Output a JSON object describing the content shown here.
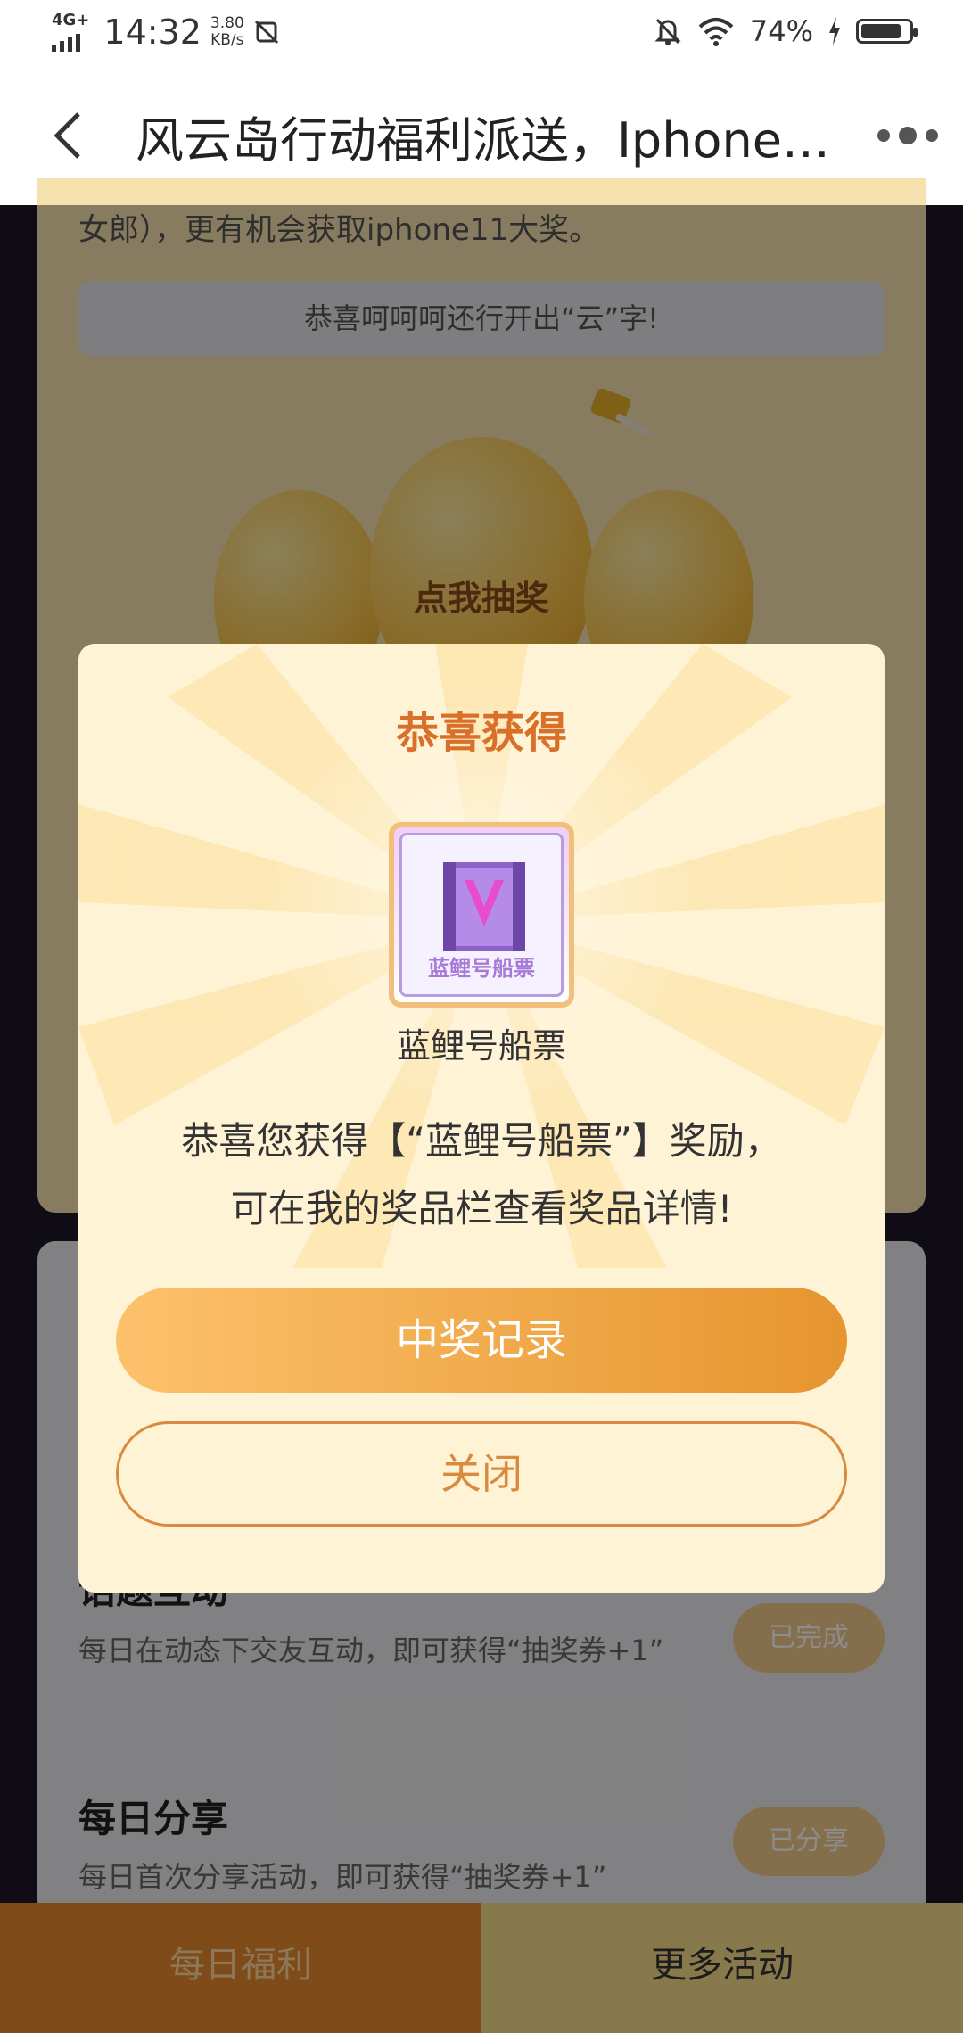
{
  "status_bar": {
    "network": "4G+",
    "time": "14:32",
    "speed_value": "3.80",
    "speed_unit": "KB/s",
    "battery": "74%"
  },
  "nav": {
    "title": "风云岛行动福利派送，Iphone…"
  },
  "page": {
    "desc": "女郎），更有机会获取iphone11大奖。",
    "notice": "恭喜呵呵呵还行开出“云”字!",
    "draw_label": "点我抽奖"
  },
  "tasks": [
    {
      "title": "话题互动",
      "desc": "每日在动态下交友互动，即可获得“抽奖券+1”",
      "button": "已完成"
    },
    {
      "title": "每日分享",
      "desc": "每日首次分享活动，即可获得“抽奖券+1”",
      "button": "已分享"
    }
  ],
  "tabs": [
    {
      "label": "每日福利"
    },
    {
      "label": "更多活动"
    }
  ],
  "dialog": {
    "title": "恭喜获得",
    "prize_image_text": "蓝鲤号船票",
    "prize_name": "蓝鲤号船票",
    "message_line1": "恭喜您获得【“蓝鲤号船票”】奖励，",
    "message_line2": "可在我的奖品栏查看奖品详情!",
    "primary_button": "中奖记录",
    "secondary_button": "关闭"
  },
  "colors": {
    "accent": "#e6952f",
    "title": "#d9702a",
    "dialog_bg": "#fff3d6"
  }
}
